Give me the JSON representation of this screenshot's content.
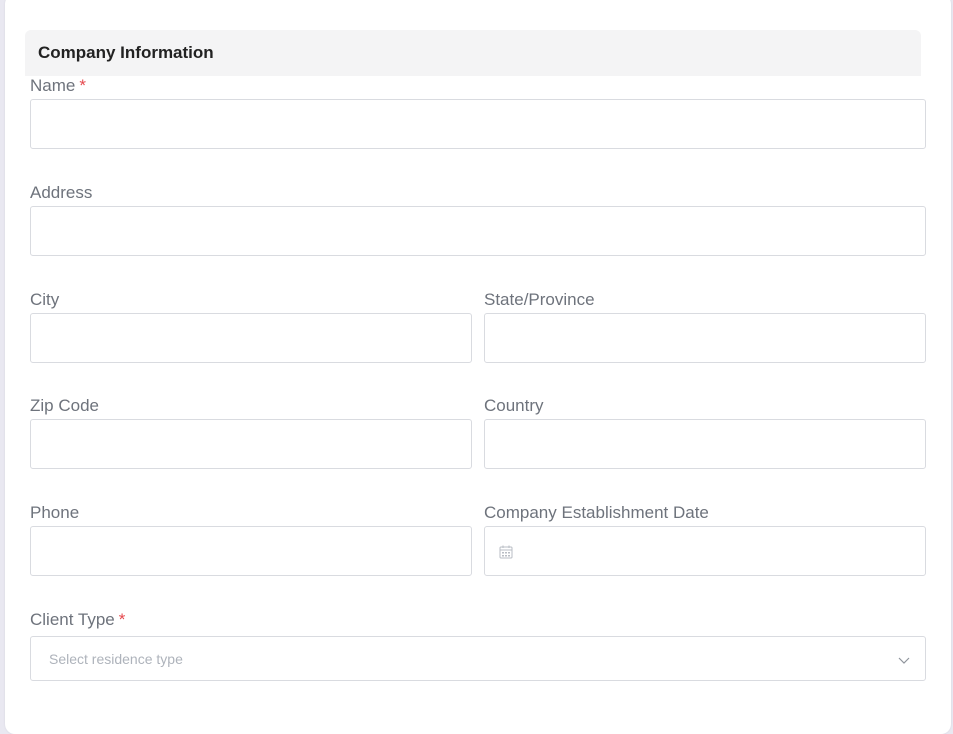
{
  "section": {
    "title": "Company Information"
  },
  "form": {
    "name": {
      "label": "Name",
      "required": "*",
      "value": ""
    },
    "address": {
      "label": "Address",
      "value": ""
    },
    "city": {
      "label": "City",
      "value": ""
    },
    "state": {
      "label": "State/Province",
      "value": ""
    },
    "zip": {
      "label": "Zip Code",
      "value": ""
    },
    "country": {
      "label": "Country",
      "value": ""
    },
    "phone": {
      "label": "Phone",
      "value": ""
    },
    "established": {
      "label": "Company Establishment Date",
      "value": "",
      "icon": "calendar-icon"
    },
    "client_type": {
      "label": "Client Type",
      "required": "*",
      "placeholder": "Select residence type",
      "icon": "chevron-down-icon"
    }
  },
  "colors": {
    "label": "#6e737c",
    "required": "#e5484d",
    "border": "#d9dbe0",
    "header_bg": "#f4f4f5",
    "placeholder": "#aeb3bb"
  }
}
